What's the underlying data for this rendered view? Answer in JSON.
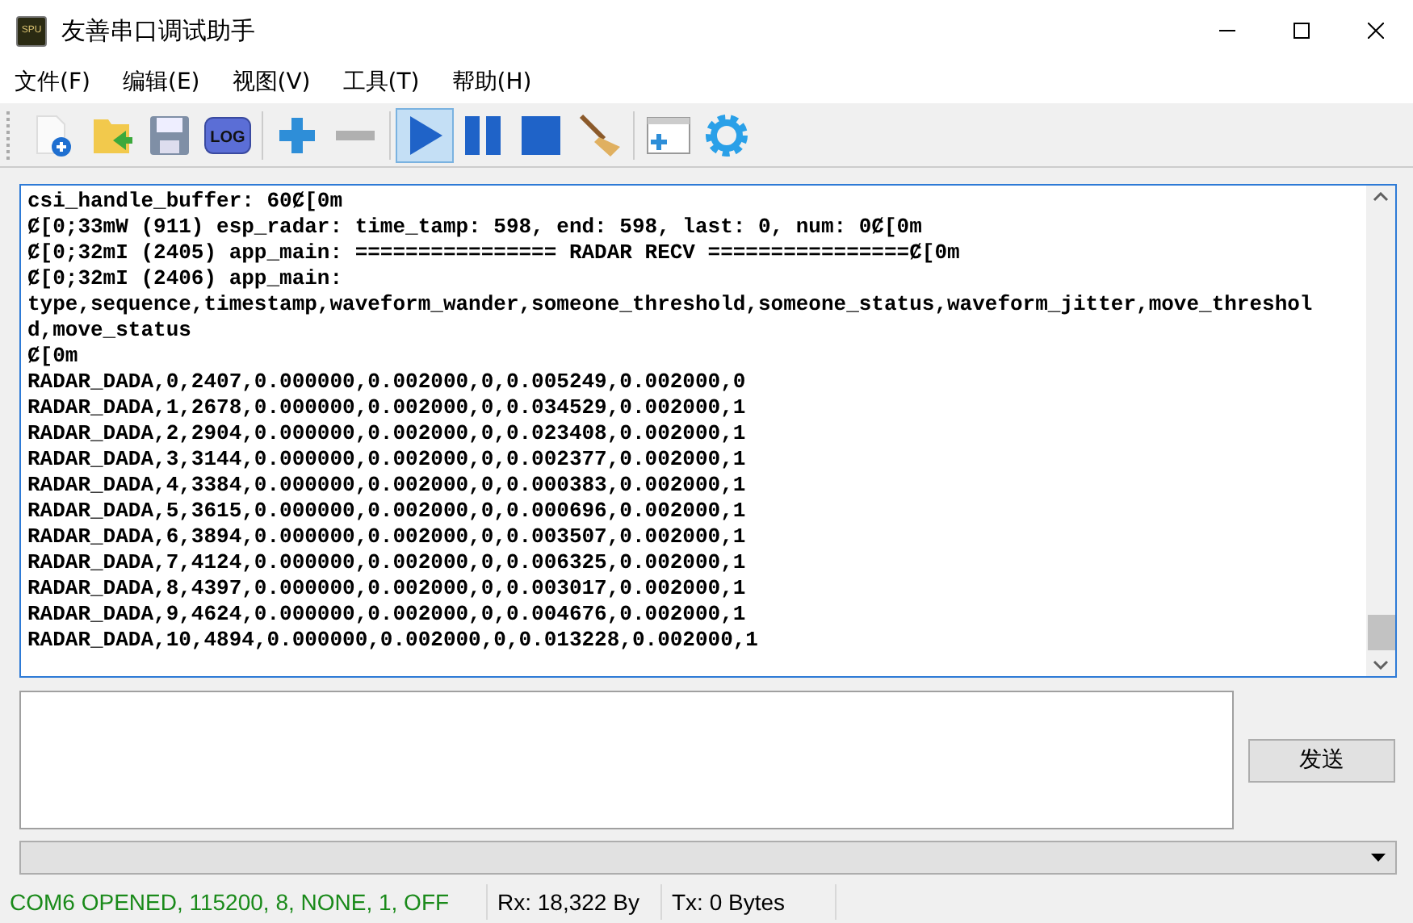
{
  "window": {
    "title": "友善串口调试助手",
    "app_icon": "SPU"
  },
  "menu": [
    {
      "label": "文件(F)"
    },
    {
      "label": "编辑(E)"
    },
    {
      "label": "视图(V)"
    },
    {
      "label": "工具(T)"
    },
    {
      "label": "帮助(H)"
    }
  ],
  "toolbar": [
    {
      "kind": "new",
      "selected": false
    },
    {
      "kind": "open",
      "selected": false
    },
    {
      "kind": "save",
      "selected": false
    },
    {
      "kind": "log",
      "label": "LOG",
      "selected": false
    },
    {
      "kind": "sep"
    },
    {
      "kind": "plus",
      "selected": false
    },
    {
      "kind": "minus",
      "selected": false
    },
    {
      "kind": "sep"
    },
    {
      "kind": "play",
      "selected": true
    },
    {
      "kind": "pause",
      "selected": false
    },
    {
      "kind": "stop",
      "selected": false
    },
    {
      "kind": "broom",
      "selected": false
    },
    {
      "kind": "sep"
    },
    {
      "kind": "window",
      "selected": false
    },
    {
      "kind": "gear",
      "selected": false
    }
  ],
  "output": {
    "lines": [
      "csi_handle_buffer: 60Ȼ[0m",
      "Ȼ[0;33mW (911) esp_radar: time_tamp: 598, end: 598, last: 0, num: 0Ȼ[0m",
      "Ȼ[0;32mI (2405) app_main: ================ RADAR RECV ================Ȼ[0m",
      "Ȼ[0;32mI (2406) app_main:",
      "type,sequence,timestamp,waveform_wander,someone_threshold,someone_status,waveform_jitter,move_threshold,move_status",
      "Ȼ[0m",
      "RADAR_DADA,0,2407,0.000000,0.002000,0,0.005249,0.002000,0",
      "RADAR_DADA,1,2678,0.000000,0.002000,0,0.034529,0.002000,1",
      "RADAR_DADA,2,2904,0.000000,0.002000,0,0.023408,0.002000,1",
      "RADAR_DADA,3,3144,0.000000,0.002000,0,0.002377,0.002000,1",
      "RADAR_DADA,4,3384,0.000000,0.002000,0,0.000383,0.002000,1",
      "RADAR_DADA,5,3615,0.000000,0.002000,0,0.000696,0.002000,1",
      "RADAR_DADA,6,3894,0.000000,0.002000,0,0.003507,0.002000,1",
      "RADAR_DADA,7,4124,0.000000,0.002000,0,0.006325,0.002000,1",
      "RADAR_DADA,8,4397,0.000000,0.002000,0,0.003017,0.002000,1",
      "RADAR_DADA,9,4624,0.000000,0.002000,0,0.004676,0.002000,1",
      "RADAR_DADA,10,4894,0.000000,0.002000,0,0.013228,0.002000,1"
    ]
  },
  "send_button": {
    "label": "发送"
  },
  "status_bar": {
    "connection": "COM6 OPENED, 115200, 8, NONE, 1, OFF",
    "rx": "Rx: 18,322 By",
    "tx": "Tx: 0 Bytes"
  }
}
